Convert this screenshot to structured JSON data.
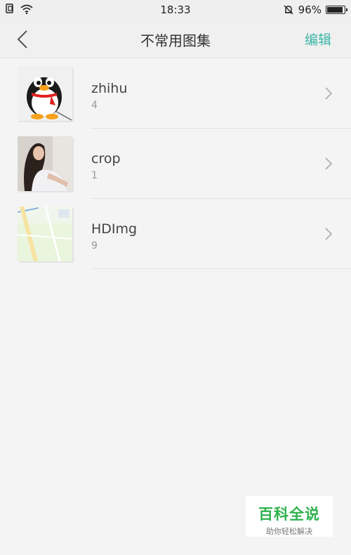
{
  "status_bar": {
    "time": "18:33",
    "battery_percent": "96%",
    "battery_level": 0.96,
    "icons": [
      "sim-icon",
      "wifi-icon",
      "alarm-off-icon",
      "battery-icon"
    ]
  },
  "header": {
    "title": "不常用图集",
    "edit_label": "编辑",
    "accent_color": "#3cb6a8"
  },
  "albums": [
    {
      "name": "zhihu",
      "count": "4"
    },
    {
      "name": "crop",
      "count": "1"
    },
    {
      "name": "HDImg",
      "count": "9"
    }
  ],
  "watermark": {
    "main": "百科全说",
    "sub": "助你轻松解决"
  }
}
